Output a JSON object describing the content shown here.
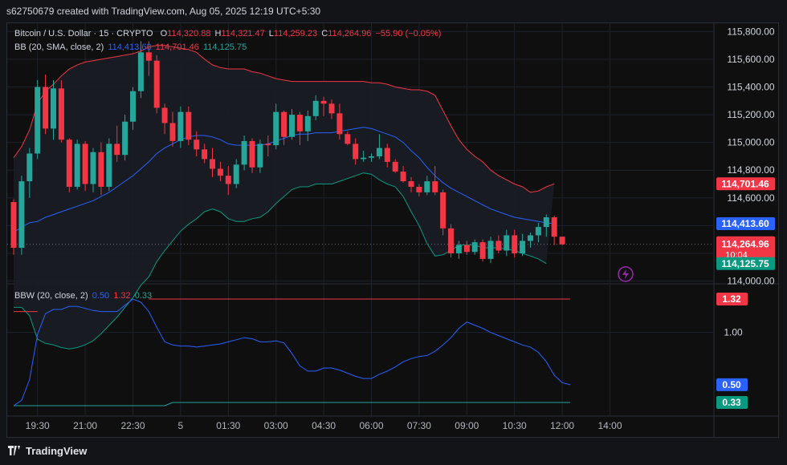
{
  "header": {
    "text": "s62750679 created with TradingView.com, Aug 05, 2025 12:19 UTC+5:30"
  },
  "footer": {
    "brand": "TradingView"
  },
  "legend_main": {
    "symbol": "Bitcoin / U.S. Dollar · 15 · CRYPTO",
    "o_label": "O",
    "o": "114,320.88",
    "h_label": "H",
    "h": "114,321.47",
    "l_label": "L",
    "l": "114,259.23",
    "c_label": "C",
    "c": "114,264.96",
    "change": "−55.90 (−0.05%)"
  },
  "legend_bb": {
    "label": "BB (20, SMA, close, 2)",
    "basis": "114,413.60",
    "upper": "114,701.46",
    "lower": "114,125.75"
  },
  "legend_bbw": {
    "label": "BBW (20, close, 2)",
    "value": "0.50",
    "high": "1.32",
    "low": "0.33"
  },
  "price_badges": {
    "upper": "114,701.46",
    "basis": "114,413.60",
    "last": "114,264.96",
    "countdown": "10:04",
    "lower": "114,125.75"
  },
  "bbw_badges": {
    "high": "1.32",
    "value": "0.50",
    "low": "0.33"
  },
  "colors": {
    "up": "#26a69a",
    "down": "#f23645",
    "basis": "#2962ff",
    "upper": "#f23645",
    "lower": "#089981",
    "bbw": "#2962ff",
    "band_fill": "#1a1d24",
    "grid": "#1e222d"
  },
  "chart_data": [
    {
      "type": "candlestick",
      "title": "Bitcoin / U.S. Dollar · 15 · CRYPTO",
      "ylim": [
        113980,
        115860
      ],
      "y_ticks": [
        "115,800.00",
        "115,600.00",
        "115,400.00",
        "115,200.00",
        "115,000.00",
        "114,800.00",
        "114,600.00",
        "114,400.00",
        "114,200.00",
        "114,000.00"
      ],
      "y_tick_values": [
        115800,
        115600,
        115400,
        115200,
        115000,
        114800,
        114600,
        114400,
        114200,
        114000
      ],
      "x_ticks": [
        "19:30",
        "21:00",
        "22:30",
        "5",
        "01:30",
        "03:00",
        "04:30",
        "06:00",
        "07:30",
        "09:00",
        "10:30",
        "12:00",
        "14:00"
      ],
      "x_tick_index": [
        3,
        9,
        15,
        21,
        27,
        33,
        39,
        45,
        51,
        57,
        63,
        69,
        75
      ],
      "candles": [
        [
          114570,
          114590,
          114190,
          114240
        ],
        [
          114240,
          114760,
          114190,
          114720
        ],
        [
          114720,
          114960,
          114600,
          114920
        ],
        [
          114920,
          115450,
          114880,
          115400
        ],
        [
          115400,
          115490,
          115060,
          115100
        ],
        [
          115100,
          115450,
          115020,
          115390
        ],
        [
          115390,
          115450,
          115000,
          115020
        ],
        [
          115020,
          115030,
          114640,
          114680
        ],
        [
          114680,
          115020,
          114660,
          114990
        ],
        [
          114990,
          115010,
          114650,
          114700
        ],
        [
          114700,
          114960,
          114640,
          114930
        ],
        [
          114930,
          115000,
          114620,
          114680
        ],
        [
          114680,
          115030,
          114650,
          114990
        ],
        [
          114990,
          115120,
          114860,
          114910
        ],
        [
          114910,
          115200,
          114870,
          115150
        ],
        [
          115150,
          115400,
          115090,
          115370
        ],
        [
          115370,
          115730,
          115320,
          115650
        ],
        [
          115650,
          115730,
          115480,
          115590
        ],
        [
          115590,
          115630,
          115210,
          115250
        ],
        [
          115250,
          115280,
          115060,
          115140
        ],
        [
          115140,
          115220,
          114970,
          115010
        ],
        [
          115010,
          115260,
          114960,
          115220
        ],
        [
          115220,
          115260,
          114980,
          115020
        ],
        [
          115020,
          115080,
          114900,
          114950
        ],
        [
          114950,
          114990,
          114850,
          114880
        ],
        [
          114880,
          114960,
          114750,
          114810
        ],
        [
          114810,
          114860,
          114720,
          114760
        ],
        [
          114760,
          114830,
          114620,
          114700
        ],
        [
          114700,
          114880,
          114670,
          114840
        ],
        [
          114840,
          115050,
          114800,
          115010
        ],
        [
          115010,
          115030,
          114780,
          114820
        ],
        [
          114820,
          115020,
          114780,
          114990
        ],
        [
          114990,
          115050,
          114900,
          114980
        ],
        [
          114980,
          115280,
          114950,
          115220
        ],
        [
          115220,
          115230,
          114980,
          115040
        ],
        [
          115040,
          115240,
          115020,
          115200
        ],
        [
          115200,
          115220,
          114980,
          115080
        ],
        [
          115080,
          115230,
          115010,
          115190
        ],
        [
          115190,
          115340,
          115160,
          115300
        ],
        [
          115300,
          115330,
          115190,
          115280
        ],
        [
          115280,
          115310,
          115170,
          115210
        ],
        [
          115210,
          115280,
          115020,
          115060
        ],
        [
          115060,
          115080,
          114980,
          114990
        ],
        [
          114990,
          115030,
          114840,
          114880
        ],
        [
          114880,
          114940,
          114860,
          114890
        ],
        [
          114890,
          114920,
          114860,
          114900
        ],
        [
          114900,
          115060,
          114880,
          114960
        ],
        [
          114960,
          114990,
          114820,
          114860
        ],
        [
          114860,
          114880,
          114780,
          114790
        ],
        [
          114790,
          114830,
          114710,
          114720
        ],
        [
          114720,
          114750,
          114640,
          114680
        ],
        [
          114680,
          114700,
          114610,
          114640
        ],
        [
          114640,
          114760,
          114620,
          114720
        ],
        [
          114720,
          114830,
          114620,
          114640
        ],
        [
          114640,
          114660,
          114330,
          114380
        ],
        [
          114380,
          114410,
          114170,
          114200
        ],
        [
          114200,
          114290,
          114160,
          114260
        ],
        [
          114260,
          114290,
          114190,
          114210
        ],
        [
          114210,
          114300,
          114190,
          114280
        ],
        [
          114280,
          114300,
          114140,
          114160
        ],
        [
          114160,
          114320,
          114130,
          114290
        ],
        [
          114290,
          114330,
          114200,
          114220
        ],
        [
          114220,
          114370,
          114180,
          114330
        ],
        [
          114330,
          114370,
          114170,
          114200
        ],
        [
          114200,
          114340,
          114180,
          114290
        ],
        [
          114290,
          114350,
          114240,
          114330
        ],
        [
          114330,
          114420,
          114280,
          114390
        ],
        [
          114390,
          114480,
          114320,
          114460
        ],
        [
          114460,
          114470,
          114260,
          114320
        ],
        [
          114320,
          114321,
          114259,
          114265
        ]
      ],
      "bb_basis": [
        114350,
        114390,
        114420,
        114430,
        114460,
        114480,
        114500,
        114520,
        114540,
        114560,
        114580,
        114610,
        114640,
        114680,
        114720,
        114760,
        114810,
        114860,
        114920,
        114960,
        114990,
        115020,
        115040,
        115050,
        115050,
        115040,
        115020,
        114990,
        114980,
        114980,
        114980,
        114980,
        114990,
        115010,
        115030,
        115050,
        115060,
        115060,
        115070,
        115070,
        115070,
        115080,
        115090,
        115100,
        115110,
        115100,
        115080,
        115060,
        115040,
        115000,
        114940,
        114890,
        114820,
        114760,
        114710,
        114670,
        114640,
        114610,
        114580,
        114550,
        114520,
        114500,
        114480,
        114460,
        114450,
        114440,
        114430,
        114420,
        114413.6
      ],
      "bb_upper": [
        114890,
        114970,
        115090,
        115280,
        115370,
        115420,
        115480,
        115530,
        115560,
        115580,
        115590,
        115600,
        115610,
        115620,
        115630,
        115640,
        115660,
        115690,
        115700,
        115700,
        115690,
        115680,
        115670,
        115650,
        115600,
        115560,
        115540,
        115530,
        115530,
        115530,
        115510,
        115500,
        115480,
        115460,
        115450,
        115440,
        115440,
        115440,
        115440,
        115440,
        115440,
        115440,
        115440,
        115440,
        115440,
        115430,
        115430,
        115420,
        115400,
        115390,
        115380,
        115380,
        115370,
        115340,
        115230,
        115120,
        115020,
        114950,
        114900,
        114860,
        114800,
        114760,
        114730,
        114700,
        114680,
        114640,
        114650,
        114680,
        114701.46
      ],
      "bb_lower": [
        113810,
        113810,
        113750,
        113580,
        113550,
        113540,
        113520,
        113510,
        113520,
        113540,
        113570,
        113620,
        113680,
        113740,
        113810,
        113880,
        113970,
        114030,
        114140,
        114220,
        114290,
        114360,
        114410,
        114450,
        114500,
        114520,
        114500,
        114450,
        114430,
        114430,
        114450,
        114460,
        114500,
        114560,
        114610,
        114660,
        114680,
        114680,
        114700,
        114700,
        114700,
        114720,
        114740,
        114760,
        114780,
        114770,
        114730,
        114700,
        114680,
        114610,
        114500,
        114400,
        114270,
        114180,
        114190,
        114220,
        114260,
        114260,
        114260,
        114240,
        114240,
        114240,
        114230,
        114220,
        114200,
        114180,
        114160,
        114125.75
      ],
      "last_price": 114264.96
    },
    {
      "type": "line",
      "title": "BBW (20, close, 2)",
      "ylim": [
        0.2,
        1.45
      ],
      "y_ticks": [
        "1.00"
      ],
      "y_tick_values": [
        1.0
      ],
      "bands": {
        "high": 1.32,
        "low": 0.33
      },
      "series": [
        {
          "name": "BBW",
          "values": [
            0.3,
            0.35,
            0.55,
            0.98,
            1.18,
            1.22,
            1.22,
            1.25,
            1.25,
            1.23,
            1.21,
            1.2,
            1.2,
            1.2,
            1.26,
            1.32,
            1.29,
            1.2,
            1.05,
            0.91,
            0.88,
            0.87,
            0.87,
            0.86,
            0.87,
            0.88,
            0.89,
            0.91,
            0.93,
            0.95,
            0.94,
            0.91,
            0.91,
            0.92,
            0.9,
            0.8,
            0.68,
            0.63,
            0.63,
            0.66,
            0.66,
            0.64,
            0.61,
            0.58,
            0.56,
            0.56,
            0.6,
            0.63,
            0.67,
            0.72,
            0.75,
            0.77,
            0.78,
            0.82,
            0.88,
            0.95,
            1.04,
            1.1,
            1.07,
            1.04,
            1.0,
            0.97,
            0.94,
            0.91,
            0.88,
            0.86,
            0.81,
            0.72,
            0.59,
            0.52,
            0.5
          ]
        }
      ]
    }
  ]
}
